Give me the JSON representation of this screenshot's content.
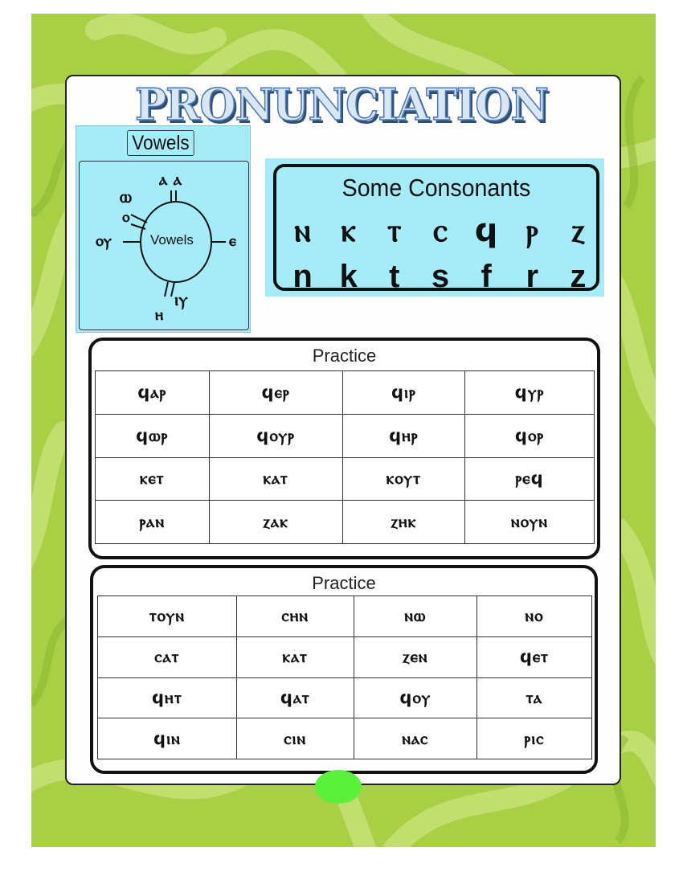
{
  "title": "PRONUNCIATION",
  "vowels": {
    "label": "Vowels",
    "center": "Vowels",
    "around": {
      "top": "ⲁ ⲁ",
      "upper_left_1": "ⲱ",
      "upper_left_2": "ⲟ",
      "left": "ⲟⲩ",
      "right": "ⲉ",
      "bottom_left": "ⲏ",
      "bottom_right": "ⲓⲩ"
    }
  },
  "consonants": {
    "title": "Some Consonants",
    "letters": [
      {
        "coptic": "ⲛ",
        "latin": "n"
      },
      {
        "coptic": "ⲕ",
        "latin": "k"
      },
      {
        "coptic": "ⲧ",
        "latin": "t"
      },
      {
        "coptic": "ⲥ",
        "latin": "s"
      },
      {
        "coptic": "ϥ",
        "latin": "f"
      },
      {
        "coptic": "ⲣ",
        "latin": "r"
      },
      {
        "coptic": "ⲍ",
        "latin": "z"
      }
    ]
  },
  "practice1": {
    "title": "Practice",
    "rows": [
      [
        "ϥⲁⲣ",
        "ϥⲉⲣ",
        "ϥⲓⲣ",
        "ϥⲩⲣ"
      ],
      [
        "ϥⲱⲣ",
        "ϥⲟⲩⲣ",
        "ϥⲏⲣ",
        "ϥⲟⲣ"
      ],
      [
        "ⲕⲉⲧ",
        "ⲕⲁⲧ",
        "ⲕⲟⲩⲧ",
        "ⲣⲉϥ"
      ],
      [
        "ⲣⲁⲛ",
        "ⲍⲁⲕ",
        "ⲍⲏⲕ",
        "ⲛⲟⲩⲛ"
      ]
    ]
  },
  "practice2": {
    "title": "Practice",
    "rows": [
      [
        "ⲧⲟⲩⲛ",
        "ⲥⲏⲛ",
        "ⲛⲱ",
        "ⲛⲟ"
      ],
      [
        "ⲥⲁⲧ",
        "ⲕⲁⲧ",
        "ⲍⲉⲛ",
        "ϥⲉⲧ"
      ],
      [
        "ϥⲏⲧ",
        "ϥⲁⲧ",
        "ϥⲟⲩ",
        "ⲧⲁ"
      ],
      [
        "ϥⲓⲛ",
        "ⲥⲓⲛ",
        "ⲛⲁⲥ",
        "ⲣⲓⲥ"
      ]
    ]
  },
  "colors": {
    "background_green": "#a9cf45",
    "panel_cyan": "#a6ecf8",
    "title_blue": "#4a79b5",
    "dot_green": "#59f23a"
  }
}
